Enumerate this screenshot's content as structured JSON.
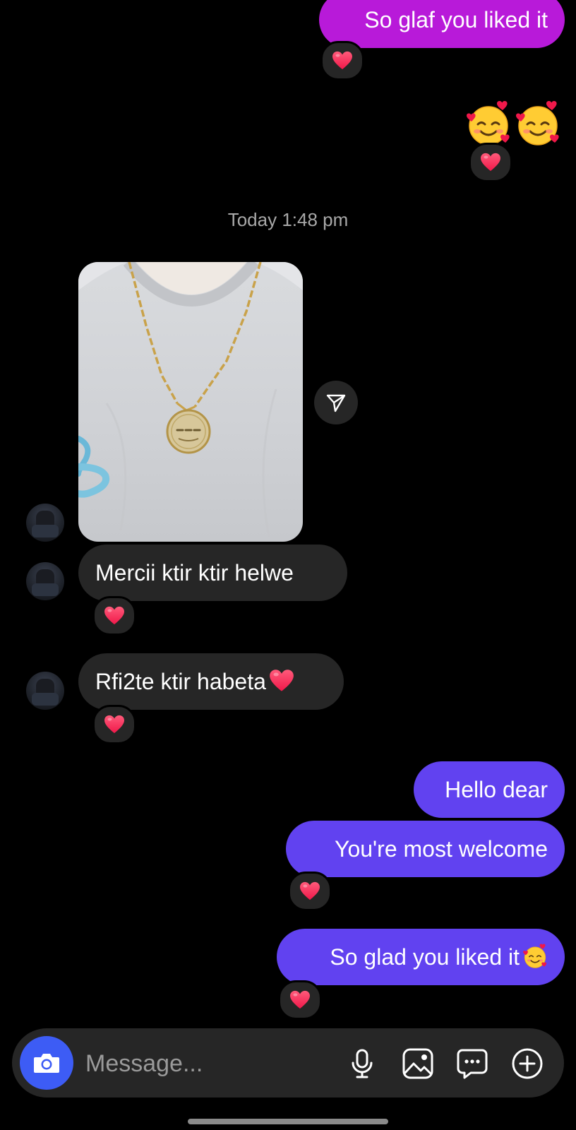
{
  "conversation": {
    "messages": [
      {
        "id": "m1",
        "direction": "outgoing",
        "text": "So glaf you liked it",
        "reaction": "heart"
      },
      {
        "id": "m2",
        "direction": "outgoing",
        "emoji": "smiling-face-with-hearts x2",
        "reaction": "heart"
      },
      {
        "id": "m3",
        "direction": "incoming",
        "attachment": "photo",
        "subject": "necklace-with-pendant"
      },
      {
        "id": "m4",
        "direction": "incoming",
        "text": "Mercii ktir ktir helwe",
        "reaction": "heart"
      },
      {
        "id": "m5",
        "direction": "incoming",
        "text": "Rfi2te ktir habeta",
        "trailing_emoji": "heart",
        "reaction": "heart"
      },
      {
        "id": "m6",
        "direction": "outgoing",
        "text": "Hello dear"
      },
      {
        "id": "m7",
        "direction": "outgoing",
        "text": "You're most welcome",
        "reaction": "heart"
      },
      {
        "id": "m8",
        "direction": "outgoing",
        "text": "So glad you liked it",
        "trailing_emoji": "smiling-face-with-hearts",
        "reaction": "heart"
      }
    ],
    "timestamp": "Today 1:48 pm"
  },
  "composer": {
    "placeholder": "Message...",
    "icons": [
      "camera-icon",
      "microphone-icon",
      "gallery-icon",
      "sticker-icon",
      "plus-icon"
    ]
  },
  "colors": {
    "background": "#000000",
    "outgoing_magenta": "#b81ad9",
    "outgoing_purple": "#6142f0",
    "incoming": "#262626",
    "camera_button": "#3d5cf5",
    "heart": "#ff2d55"
  }
}
